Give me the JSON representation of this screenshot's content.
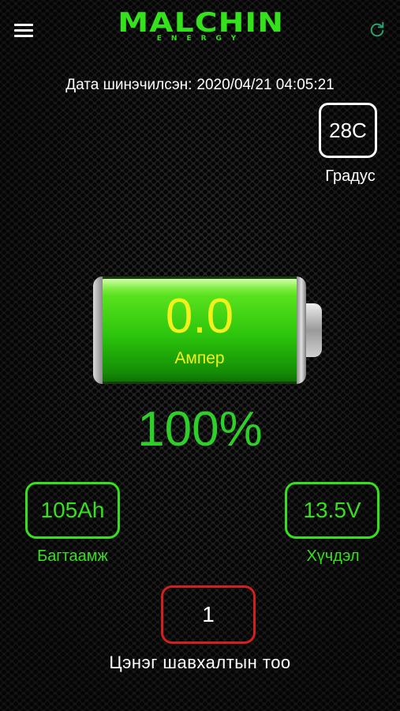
{
  "header": {
    "logo_main": "MALCHIN",
    "logo_sub": "ENERGY",
    "menu_icon": "hamburger-menu-icon",
    "refresh_icon": "refresh-icon",
    "accent_color": "#33e21a"
  },
  "updated": {
    "label": "Дата шинэчилсэн:",
    "value": "2020/04/21 04:05:21"
  },
  "temperature": {
    "value": "28C",
    "label": "Градус"
  },
  "battery": {
    "current_value": "0.0",
    "current_unit": "Ампер",
    "charge_percent": "100%",
    "charge_level": 1.0,
    "fill_color": "#2cc40c"
  },
  "capacity": {
    "value": "105Ah",
    "label": "Багтаамж"
  },
  "voltage": {
    "value": "13.5V",
    "label": "Хүчдэл"
  },
  "charge_count": {
    "value": "1",
    "label": "Цэнэг шавхалтын тоо",
    "border_color": "#d21f1f"
  }
}
